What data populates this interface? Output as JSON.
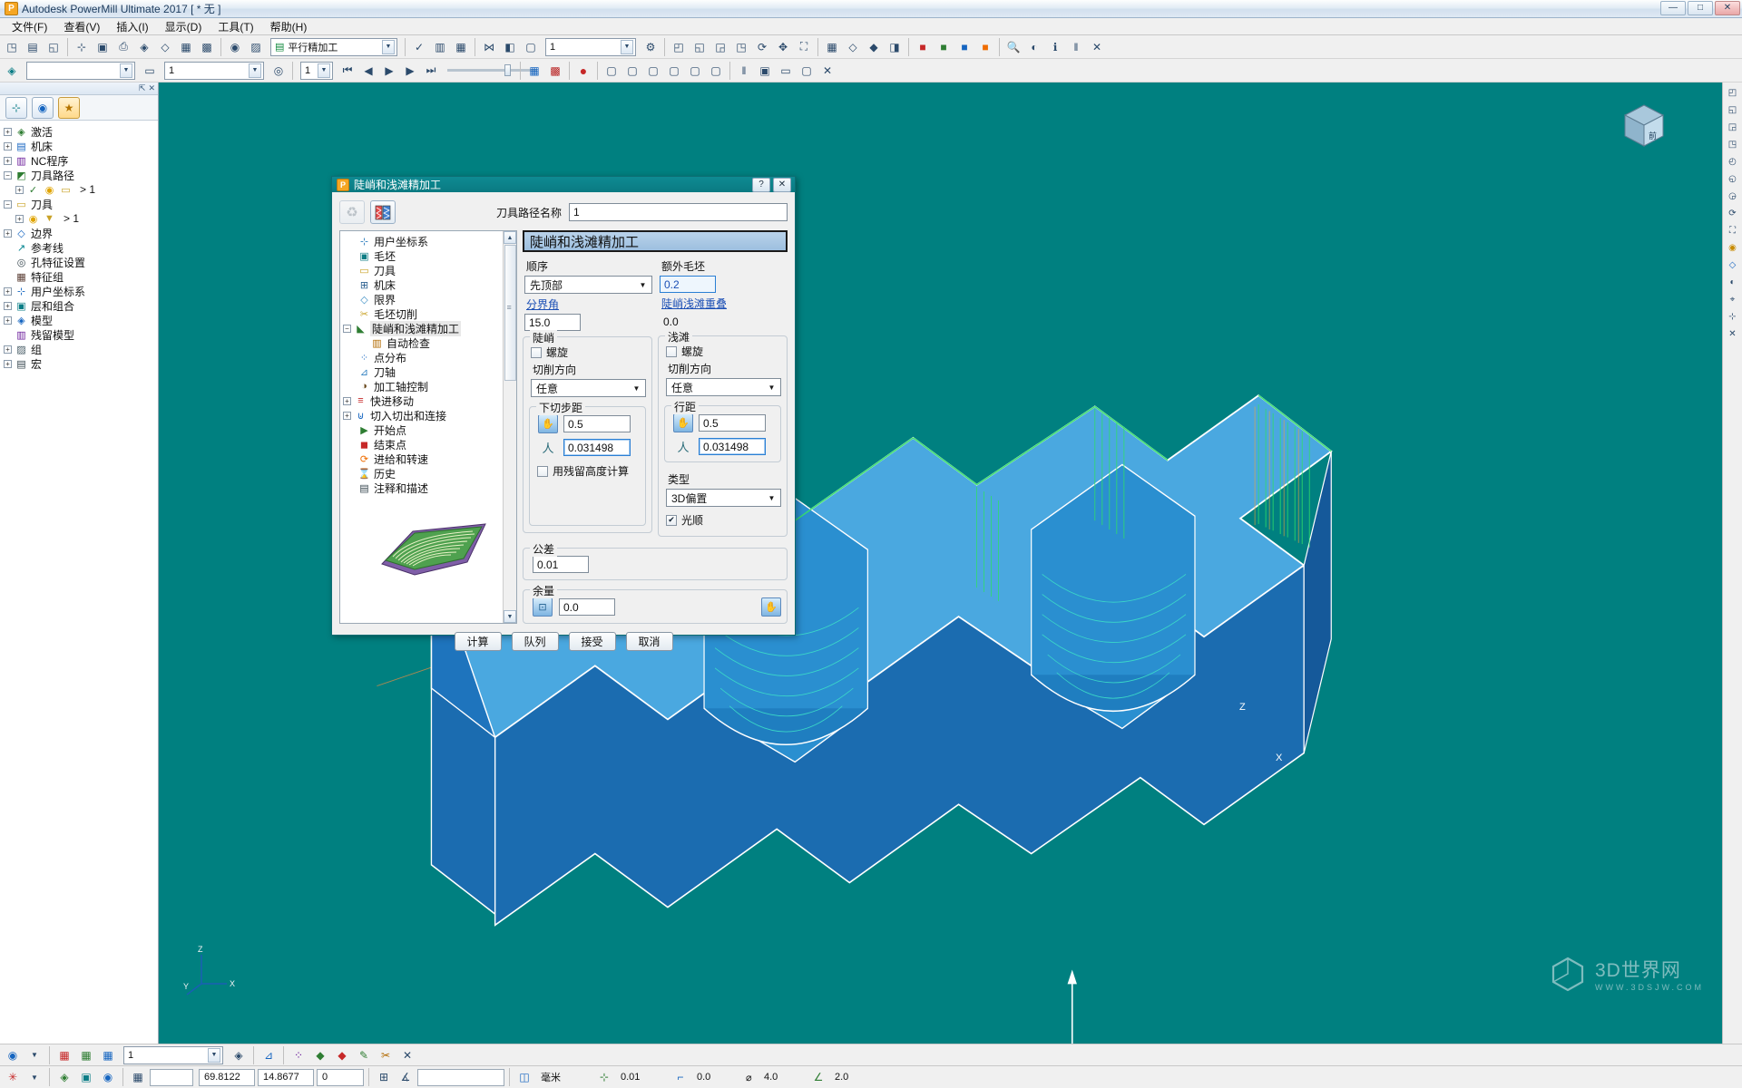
{
  "window": {
    "title": "Autodesk PowerMill Ultimate 2017    [ * 无 ]",
    "logo": "P",
    "buttons": {
      "minimize": "—",
      "maximize": "□",
      "close": "✕"
    }
  },
  "menubar": {
    "items": [
      {
        "label": "文件(F)",
        "name": "menu-file"
      },
      {
        "label": "查看(V)",
        "name": "menu-view"
      },
      {
        "label": "插入(I)",
        "name": "menu-insert"
      },
      {
        "label": "显示(D)",
        "name": "menu-display"
      },
      {
        "label": "工具(T)",
        "name": "menu-tools"
      },
      {
        "label": "帮助(H)",
        "name": "menu-help"
      }
    ]
  },
  "toolbar_main": {
    "strategy_combo": {
      "value": "平行精加工",
      "icon": "strategy-icon"
    },
    "number_combo": {
      "value": "1"
    },
    "icons": [
      "new-project-icon",
      "save-icon",
      "open-icon",
      "print-icon",
      "measure-icon",
      "block-icon",
      "toolpath-icon",
      "simulate-icon",
      "tool-icon",
      "boundary-icon",
      "pattern-icon",
      "feature-icon",
      "machine-icon"
    ]
  },
  "toolbar_second": {
    "level_combo": {
      "value": ""
    },
    "count_combo": {
      "value": "1"
    },
    "step_combo": {
      "value": "1"
    },
    "transport": [
      "⏮",
      "◀",
      "▶",
      "▶",
      "⏭"
    ],
    "record_icon": "record-icon"
  },
  "explorer": {
    "tabs": [
      {
        "name": "tab-explorer",
        "icon": "tree-icon",
        "selected": false
      },
      {
        "name": "tab-world",
        "icon": "globe-icon",
        "selected": false
      },
      {
        "name": "tab-favorites",
        "icon": "star-icon",
        "selected": true
      }
    ],
    "tree": [
      {
        "label": "激活",
        "icon": "⊞",
        "expand": "+",
        "suffix": ""
      },
      {
        "label": "机床",
        "icon": "⊟",
        "expand": "+",
        "suffix": ""
      },
      {
        "label": "NC程序",
        "icon": "▤",
        "expand": "+",
        "suffix": ""
      },
      {
        "label": "刀具路径",
        "icon": "◩",
        "expand": "−",
        "suffix": ""
      },
      {
        "label": "",
        "icon": "✓",
        "expand": "+",
        "suffix": "> 1",
        "child": true
      },
      {
        "label": "刀具",
        "icon": "▭",
        "expand": "−",
        "suffix": ""
      },
      {
        "label": "",
        "icon": "▼",
        "expand": "+",
        "suffix": "> 1",
        "child": true
      },
      {
        "label": "边界",
        "icon": "◇",
        "expand": "+",
        "suffix": ""
      },
      {
        "label": "参考线",
        "icon": "↗",
        "expand": "",
        "suffix": ""
      },
      {
        "label": "孔特征设置",
        "icon": "◎",
        "expand": "",
        "suffix": ""
      },
      {
        "label": "特征组",
        "icon": "▦",
        "expand": "",
        "suffix": ""
      },
      {
        "label": "用户坐标系",
        "icon": "⊹",
        "expand": "+",
        "suffix": ""
      },
      {
        "label": "层和组合",
        "icon": "▣",
        "expand": "+",
        "suffix": ""
      },
      {
        "label": "模型",
        "icon": "◈",
        "expand": "+",
        "suffix": ""
      },
      {
        "label": "残留模型",
        "icon": "▥",
        "expand": "",
        "suffix": ""
      },
      {
        "label": "组",
        "icon": "▨",
        "expand": "+",
        "suffix": ""
      },
      {
        "label": "宏",
        "icon": "▤",
        "expand": "+",
        "suffix": ""
      }
    ]
  },
  "dialog": {
    "title": "陡峭和浅滩精加工",
    "logo": "P",
    "help_button": "?",
    "close_button": "✕",
    "toolpath_name_label": "刀具路径名称",
    "toolpath_name_value": "1",
    "tool_buttons": [
      {
        "name": "recycle-button",
        "icon": "♻"
      },
      {
        "name": "strategy-select-button",
        "icon": "▚"
      }
    ],
    "tree": [
      {
        "label": "用户坐标系",
        "icon": "⊹",
        "expand": "",
        "indent": 1,
        "selected": false
      },
      {
        "label": "毛坯",
        "icon": "▣",
        "expand": "",
        "indent": 1,
        "selected": false
      },
      {
        "label": "刀具",
        "icon": "▭",
        "expand": "",
        "indent": 1,
        "selected": false
      },
      {
        "label": "机床",
        "icon": "⊞",
        "expand": "",
        "indent": 1,
        "selected": false
      },
      {
        "label": "限界",
        "icon": "◇",
        "expand": "",
        "indent": 1,
        "selected": false
      },
      {
        "label": "毛坯切削",
        "icon": "✂",
        "expand": "",
        "indent": 1,
        "selected": false
      },
      {
        "label": "陡峭和浅滩精加工",
        "icon": "◣",
        "expand": "−",
        "indent": 0,
        "selected": true
      },
      {
        "label": "自动检查",
        "icon": "▥",
        "expand": "",
        "indent": 2,
        "selected": false
      },
      {
        "label": "点分布",
        "icon": "⁘",
        "expand": "",
        "indent": 1,
        "selected": false
      },
      {
        "label": "刀轴",
        "icon": "⊿",
        "expand": "",
        "indent": 1,
        "selected": false
      },
      {
        "label": "加工轴控制",
        "icon": "◑",
        "expand": "",
        "indent": 1,
        "selected": false
      },
      {
        "label": "快进移动",
        "icon": "≡",
        "expand": "+",
        "indent": 0,
        "selected": false
      },
      {
        "label": "切入切出和连接",
        "icon": "⊍",
        "expand": "+",
        "indent": 0,
        "selected": false
      },
      {
        "label": "开始点",
        "icon": "▶",
        "expand": "",
        "indent": 1,
        "selected": false
      },
      {
        "label": "结束点",
        "icon": "◼",
        "expand": "",
        "indent": 1,
        "selected": false
      },
      {
        "label": "进给和转速",
        "icon": "⟳",
        "expand": "",
        "indent": 1,
        "selected": false
      },
      {
        "label": "历史",
        "icon": "⌛",
        "expand": "",
        "indent": 1,
        "selected": false
      },
      {
        "label": "注释和描述",
        "icon": "▤",
        "expand": "",
        "indent": 1,
        "selected": false
      }
    ],
    "form": {
      "header": "陡峭和浅滩精加工",
      "order_label": "顺序",
      "order_value": "先顶部",
      "extra_block_label": "额外毛坯",
      "extra_block_value": "0.2",
      "threshold_angle_label": "分界角",
      "threshold_angle_value": "15.0",
      "overlap_label": "陡峭浅滩重叠",
      "overlap_value": "0.0",
      "steep": {
        "title": "陡峭",
        "spiral_label": "螺旋",
        "spiral_checked": false,
        "cut_direction_label": "切削方向",
        "cut_direction_value": "任意",
        "stepdown_title": "下切步距",
        "stepdown_value": "0.5",
        "stepdown_second_value": "0.031498",
        "scallop_label": "用残留高度计算",
        "scallop_checked": false
      },
      "shallow": {
        "title": "浅滩",
        "spiral_label": "螺旋",
        "spiral_checked": false,
        "cut_direction_label": "切削方向",
        "cut_direction_value": "任意",
        "stepover_title": "行距",
        "stepover_value": "0.5",
        "stepover_second_value": "0.031498",
        "type_label": "类型",
        "type_value": "3D偏置",
        "smooth_label": "光顺",
        "smooth_checked": true
      },
      "tolerance_label": "公差",
      "tolerance_value": "0.01",
      "thickness_label": "余量",
      "thickness_value": "0.0"
    },
    "footer_buttons": [
      {
        "label": "计算",
        "name": "calculate-button"
      },
      {
        "label": "队列",
        "name": "queue-button"
      },
      {
        "label": "接受",
        "name": "accept-button"
      },
      {
        "label": "取消",
        "name": "cancel-button"
      }
    ]
  },
  "viewport": {
    "axis_labels": {
      "x": "X",
      "y": "Y",
      "z": "Z"
    },
    "view_cube_label": "前",
    "watermark_title": "3D世界网",
    "watermark_sub": "WWW.3DSJW.COM"
  },
  "bottombar": {
    "level_value": "1",
    "icons": [
      "user-icon",
      "layer1-icon",
      "layer2-icon",
      "layer3-icon",
      "view-icon",
      "pencil-icon",
      "scissors-icon",
      "close-icon"
    ]
  },
  "statusbar": {
    "coord_x": "69.8122",
    "coord_y": "14.8677",
    "coord_z": "0",
    "units_label": "毫米",
    "tolerance_value": "0.01",
    "thickness_value": "0.0",
    "diameter_label": "⌀",
    "diameter_value": "4.0",
    "angle_value": "2.0",
    "input_value": ""
  }
}
